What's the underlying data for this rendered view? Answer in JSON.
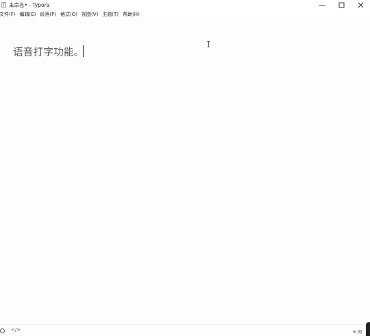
{
  "window": {
    "title": "未命名• - Typora",
    "app_icon_glyph": "T"
  },
  "menu": {
    "items": [
      {
        "label": "文件(F)"
      },
      {
        "label": "编辑(E)"
      },
      {
        "label": "段落(P)"
      },
      {
        "label": "格式(O)"
      },
      {
        "label": "视图(V)"
      },
      {
        "label": "主题(T)"
      },
      {
        "label": "帮助(H)"
      }
    ]
  },
  "editor": {
    "content": "语音打字功能。"
  },
  "statusbar": {
    "code_toggle": "</>",
    "word_count": "6 词"
  },
  "icons": {
    "minimize": "minimize-icon",
    "maximize": "maximize-icon",
    "close": "close-icon",
    "outline": "outline-circle-icon",
    "source": "source-code-icon"
  }
}
